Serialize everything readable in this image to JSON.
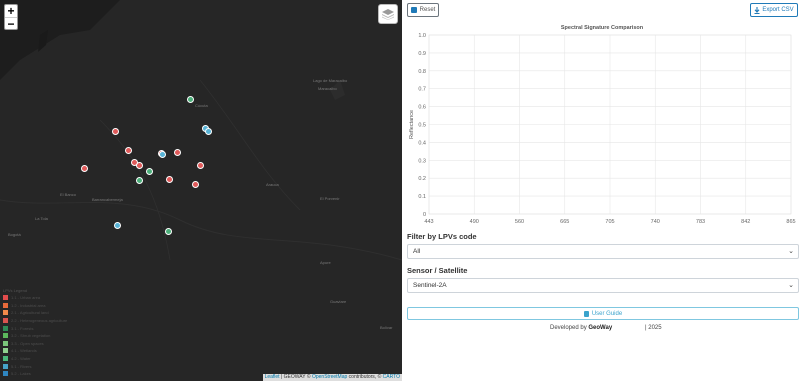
{
  "map": {
    "zoom_in": "+",
    "zoom_out": "−",
    "places": [
      {
        "name": "Lago de Maracaibo"
      },
      {
        "name": "Maracaibo"
      },
      {
        "name": "Cúcuta"
      },
      {
        "name": "El Banco"
      },
      {
        "name": "Barrancabermeja"
      },
      {
        "name": "El Porvenir"
      },
      {
        "name": "Arauca"
      },
      {
        "name": "La Tola"
      },
      {
        "name": "Guaviare"
      },
      {
        "name": "Bogotá"
      },
      {
        "name": "Bolívar"
      },
      {
        "name": "Apure"
      }
    ],
    "markers": [
      {
        "color": "#4caf7a"
      },
      {
        "color": "#57b3d6"
      },
      {
        "color": "#57b3d6"
      },
      {
        "color": "#e05a5a"
      },
      {
        "color": "#e05a5a"
      },
      {
        "color": "#e05a5a"
      },
      {
        "color": "#e05a5a"
      },
      {
        "color": "#57b3d6"
      },
      {
        "color": "#e05a5a"
      },
      {
        "color": "#e05a5a"
      },
      {
        "color": "#e05a5a"
      },
      {
        "color": "#4caf7a"
      },
      {
        "color": "#4caf7a"
      },
      {
        "color": "#e05a5a"
      },
      {
        "color": "#e05a5a"
      },
      {
        "color": "#e05a5a"
      },
      {
        "color": "#57b3d6"
      },
      {
        "color": "#4caf7a"
      }
    ],
    "legend": {
      "title": "LPVs Legend",
      "items": [
        {
          "label": "1.1 - Urban area",
          "color": "#e24c4c"
        },
        {
          "label": "1.2 - Industrial area",
          "color": "#e86a3a"
        },
        {
          "label": "2.1 - Agricultural land",
          "color": "#f08a4b"
        },
        {
          "label": "2.2 - Heterogeneous agriculture",
          "color": "#d9534f"
        },
        {
          "label": "3.1 - Forests",
          "color": "#2e8b57"
        },
        {
          "label": "3.2 - Shrub vegetation",
          "color": "#5cb85c"
        },
        {
          "label": "3.3 - Open spaces",
          "color": "#7bc67b"
        },
        {
          "label": "4.1 - Wetlands",
          "color": "#8fd18f"
        },
        {
          "label": "4.2 - Water",
          "color": "#4ab87a"
        },
        {
          "label": "5.1 - Rivers",
          "color": "#46a3c8"
        },
        {
          "label": "5.2 - Lakes",
          "color": "#2f86c1"
        }
      ]
    },
    "attribution": {
      "leaflet": "Leaflet",
      "sep1": " | GEOWAY © ",
      "osm": "OpenStreetMap",
      "sep2": " contributors, © ",
      "carto": "CARTO"
    }
  },
  "panel": {
    "reset_label": "Reset",
    "export_label": "Export CSV",
    "filter_label": "Filter by LPVs code",
    "filter_value": "All",
    "sensor_label": "Sensor / Satellite",
    "sensor_value": "Sentinel-2A",
    "guide_label": "User Guide",
    "footer_dev": "Developed by",
    "footer_brand": "GeoWay",
    "footer_year": "| 2025"
  },
  "chart_data": {
    "type": "line",
    "title": "Spectral Signature Comparison",
    "xlabel": "",
    "ylabel": "Reflectance",
    "categories": [
      "443",
      "490",
      "560",
      "665",
      "705",
      "740",
      "783",
      "842",
      "865"
    ],
    "yticks": [
      "0",
      "0.1",
      "0.2",
      "0.3",
      "0.4",
      "0.5",
      "0.6",
      "0.7",
      "0.8",
      "0.9",
      "1.0"
    ],
    "ylim": [
      0,
      1
    ],
    "grid": true,
    "series": []
  }
}
